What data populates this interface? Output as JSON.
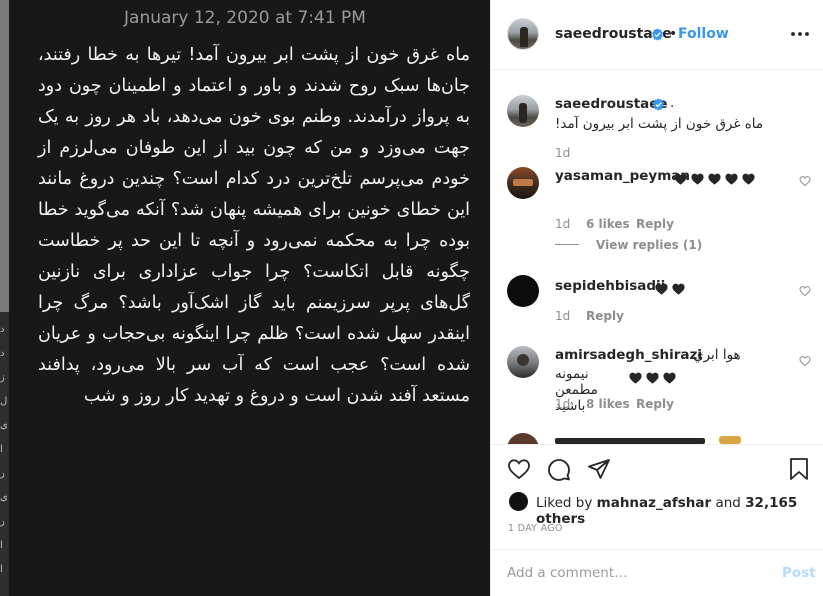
{
  "photo": {
    "date": "January 12, 2020 at 7:41 PM",
    "text": "ماه غرق خون از پشت ابر بیرون آمد! تیرها به خطا رفتند، جان‌ها سبک روح شدند و باور و اعتماد و اطمینان چون دود به پرواز درآمدند. وطنم بوی خون می‌دهد، باد هر روز به یک جهت می‌وزد و من که چون بید از این طوفان می‌لرزم از خودم می‌پرسم تلخ‌ترین درد کدام است؟ چندین دروغ مانند این خطای خونین برای همیشه پنهان شد؟ آنکه می‌گوید خطا بوده چرا به محکمه نمی‌رود و آنچه تا این حد پر خطاست چگونه قابل اتکاست؟ چرا جواب عزاداری برای نازنین گل‌های پرپر سرزیمنم باید گاز اشک‌آور باشد؟ مرگ چرا اینقدر سهل شده است؟ ظلم چرا اینگونه بی‌حجاب و عریان شده است؟ عجب است که آب سر بالا می‌رود، پدافند مستعد آفند شدن است و دروغ و تهدید کار روز و شب",
    "strip_glyphs": [
      "د",
      "د",
      "ز",
      "ل",
      "ی",
      "ا",
      "ر",
      "ی",
      "ر",
      "ا",
      "ا"
    ]
  },
  "header": {
    "username": "saeedroustaee",
    "dot": "•",
    "follow": "Follow",
    "more_icon": "more-horizontal-icon"
  },
  "caption": {
    "username": "saeedroustaee",
    "suffix": ".",
    "text": "ماه غرق خون از پشت ابر بیرون آمد!",
    "time": "1d"
  },
  "comments": [
    {
      "username": "yasaman_peyman",
      "hearts": 5,
      "time": "1d",
      "likes": "6 likes",
      "reply": "Reply",
      "view_replies": "View replies (1)"
    },
    {
      "username": "sepidehbisadii",
      "hearts": 2,
      "time": "1d",
      "reply": "Reply"
    },
    {
      "username": "amirsadegh_shirazi",
      "text_line1": "هوا ابري",
      "text_line2": "نیمونه مطمعن باشید",
      "hearts": 3,
      "time": "1d",
      "likes": "8 likes",
      "reply": "Reply"
    }
  ],
  "actions": {
    "likes_prefix": "Liked by",
    "liked_by": "mahnaz_afshar",
    "likes_mid": "and",
    "likes_count": "32,165 others",
    "time_ago": "1 DAY AGO"
  },
  "add_comment": {
    "placeholder": "Add a comment…",
    "post": "Post"
  },
  "colors": {
    "link": "#3897f0",
    "verified": "#3897f0",
    "post_disabled": "#b3dbff",
    "muted": "#8e8e8e"
  }
}
